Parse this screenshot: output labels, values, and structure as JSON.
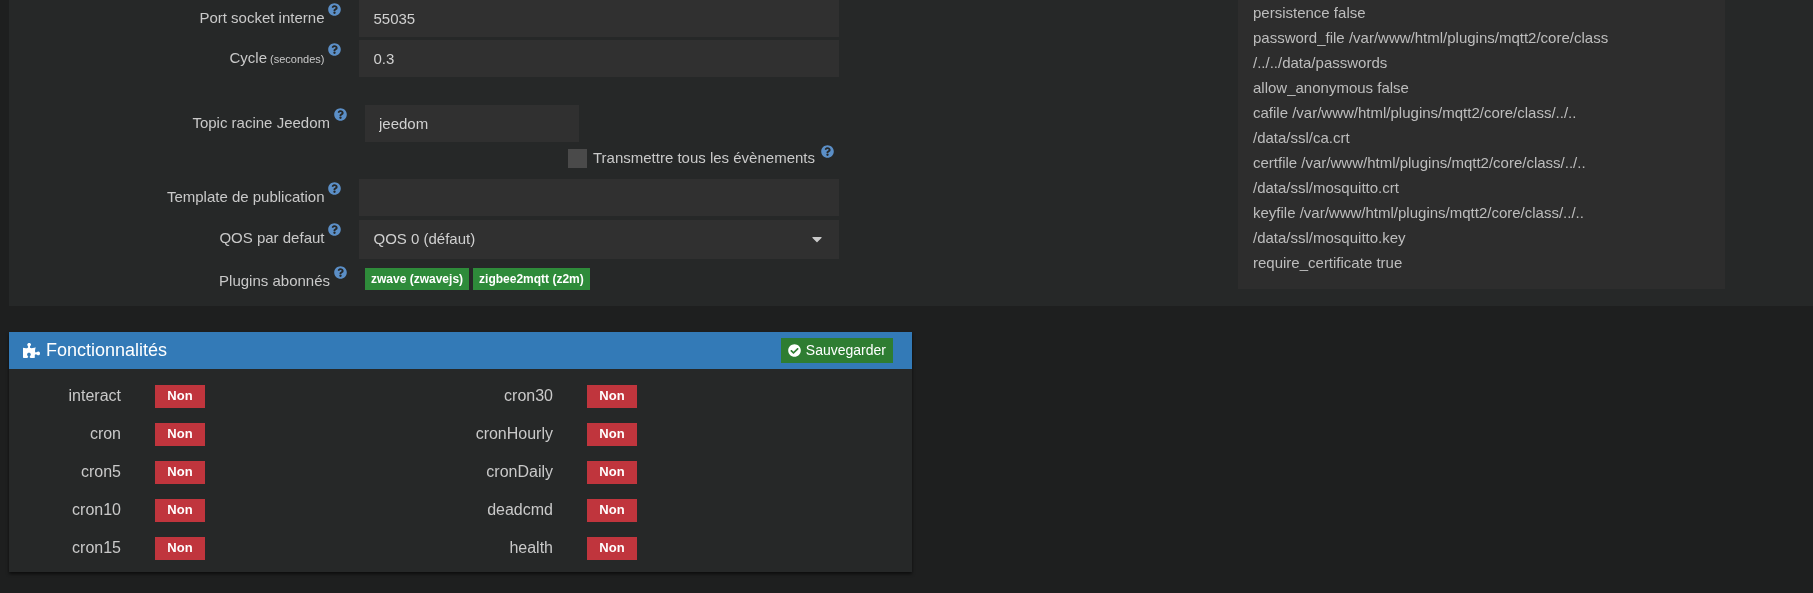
{
  "settings_form": {
    "fields": [
      {
        "kind": "text",
        "label": "Port socket interne",
        "value": "55035"
      },
      {
        "kind": "text",
        "label": "Cycle",
        "label_sub": "(secondes)",
        "value": "0.3"
      },
      {
        "kind": "text-short",
        "label": "Topic racine Jeedom",
        "value": "jeedom"
      },
      {
        "kind": "checkbox",
        "label": "Transmettre tous les évènements",
        "checked": false
      },
      {
        "kind": "text",
        "label": "Template de publication"
      },
      {
        "kind": "select",
        "label": "QOS par defaut",
        "value": "QOS 0 (défaut)"
      },
      {
        "kind": "tags",
        "label": "Plugins abonnés",
        "tags": [
          "zwave (zwavejs)",
          "zigbee2mqtt (z2m)"
        ]
      }
    ]
  },
  "config_textarea": {
    "lines": [
      "persistence false",
      "password_file /var/www/html/plugins/mqtt2/core/class",
      "/../../data/passwords",
      "allow_anonymous false",
      "cafile /var/www/html/plugins/mqtt2/core/class/../..",
      "/data/ssl/ca.crt",
      "certfile /var/www/html/plugins/mqtt2/core/class/../..",
      "/data/ssl/mosquitto.crt",
      "keyfile /var/www/html/plugins/mqtt2/core/class/../..",
      "/data/ssl/mosquitto.key",
      "require_certificate true"
    ]
  },
  "features_panel": {
    "title": "Fonctionnalités",
    "save_button": "Sauvegarder",
    "columns": [
      [
        {
          "name": "interact",
          "state": "Non",
          "enabled": false
        },
        {
          "name": "cron",
          "state": "Non",
          "enabled": false
        },
        {
          "name": "cron5",
          "state": "Non",
          "enabled": false
        },
        {
          "name": "cron10",
          "state": "Non",
          "enabled": false
        },
        {
          "name": "cron15",
          "state": "Non",
          "enabled": false
        }
      ],
      [
        {
          "name": "cron30",
          "state": "Non",
          "enabled": false
        },
        {
          "name": "cronHourly",
          "state": "Non",
          "enabled": false
        },
        {
          "name": "cronDaily",
          "state": "Non",
          "enabled": false
        },
        {
          "name": "deadcmd",
          "state": "Non",
          "enabled": false
        },
        {
          "name": "health",
          "state": "Non",
          "enabled": false
        }
      ]
    ]
  }
}
